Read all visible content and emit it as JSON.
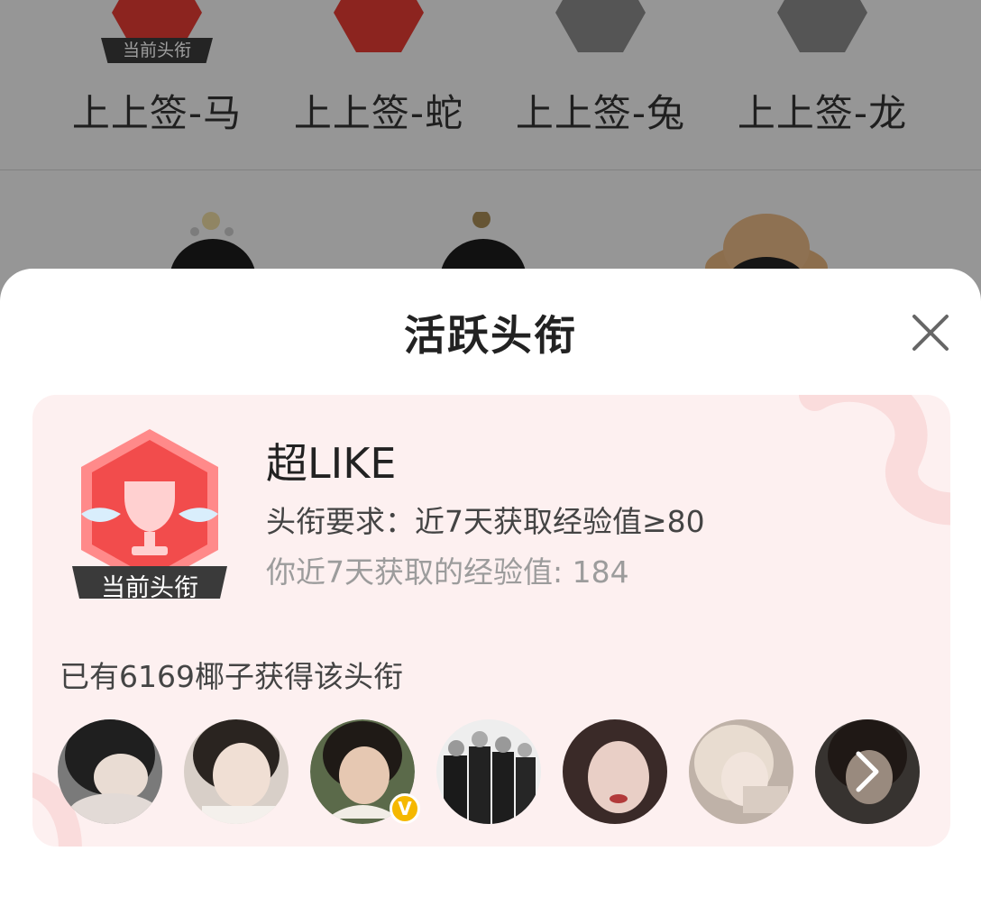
{
  "background": {
    "badges": [
      {
        "name": "上上签-马",
        "tag": "当前头衔",
        "color": "#e23b32"
      },
      {
        "name": "上上签-蛇",
        "tag": "",
        "color": "#e23b32"
      },
      {
        "name": "上上签-兔",
        "tag": "",
        "color": "#8a8a8a"
      },
      {
        "name": "上上签-龙",
        "tag": "",
        "color": "#8a8a8a"
      }
    ]
  },
  "sheet": {
    "title": "活跃头衔",
    "close_icon": "close-icon"
  },
  "card": {
    "badge_tag": "当前头衔",
    "title_name": "超LIKE",
    "requirement": "头衔要求：近7天获取经验值≥80",
    "my_value": "你近7天获取的经验值: 184",
    "owners": "已有6169椰子获得该头衔",
    "accent_color": "#f24c4c",
    "avatars": [
      {
        "name": "avatar-1",
        "tone": "#6b6b6b"
      },
      {
        "name": "avatar-2",
        "tone": "#c9bfb8"
      },
      {
        "name": "avatar-3",
        "tone": "#5f6a4e",
        "verified": "V"
      },
      {
        "name": "avatar-4",
        "tone": "#2a2a2a"
      },
      {
        "name": "avatar-5",
        "tone": "#7a4a45"
      },
      {
        "name": "avatar-6",
        "tone": "#c8b3a8"
      },
      {
        "name": "avatar-7",
        "tone": "#4a4440",
        "more_icon": "chevron-right-icon"
      }
    ]
  }
}
